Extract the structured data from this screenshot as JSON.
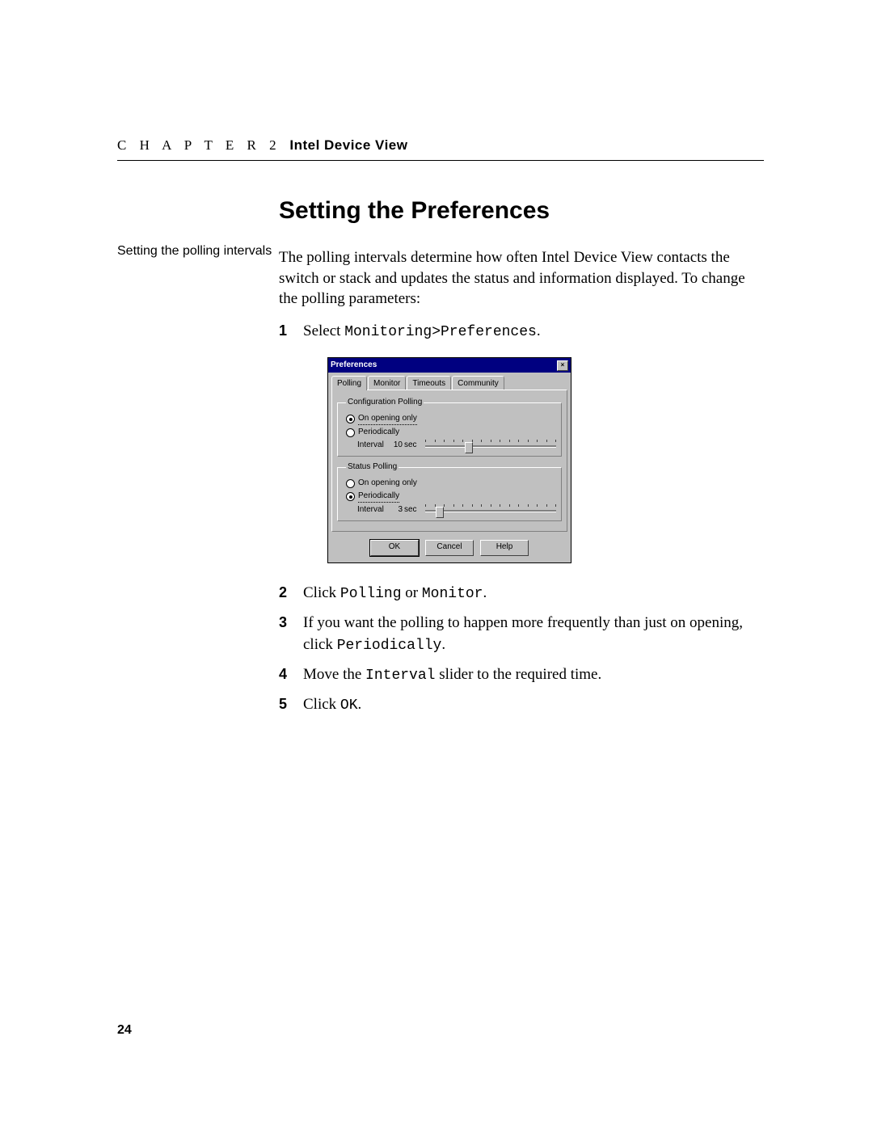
{
  "header": {
    "chapter": "C H A P T E R 2",
    "title": "Intel Device View"
  },
  "page_number": "24",
  "section_title": "Setting the Preferences",
  "sidebar_note": "Setting the polling intervals",
  "intro": "The polling intervals determine how often Intel Device View contacts the switch or stack and updates the status and information displayed. To change the polling parameters:",
  "steps": {
    "s1_pre": "Select ",
    "s1_mono": "Monitoring>Preferences",
    "s1_post": ".",
    "s2_pre": "Click ",
    "s2_mono1": "Polling",
    "s2_mid": " or ",
    "s2_mono2": "Monitor",
    "s2_post": ".",
    "s3_pre": "If you want the polling to happen more frequently than just on opening, click ",
    "s3_mono": "Periodically",
    "s3_post": ".",
    "s4_pre": "Move the ",
    "s4_mono": "Interval",
    "s4_post": " slider to the required time.",
    "s5_pre": "Click ",
    "s5_mono": "OK",
    "s5_post": "."
  },
  "dialog": {
    "title": "Preferences",
    "tabs": [
      "Polling",
      "Monitor",
      "Timeouts",
      "Community"
    ],
    "active_tab": "Polling",
    "group1": {
      "legend": "Configuration Polling",
      "opt_open": "On opening only",
      "opt_periodic": "Periodically",
      "selected": "open",
      "interval_label": "Interval",
      "interval_value": "10",
      "interval_unit": "sec",
      "slider_pos_pct": 30
    },
    "group2": {
      "legend": "Status Polling",
      "opt_open": "On opening only",
      "opt_periodic": "Periodically",
      "selected": "periodic",
      "interval_label": "Interval",
      "interval_value": "3",
      "interval_unit": "sec",
      "slider_pos_pct": 8
    },
    "buttons": {
      "ok": "OK",
      "cancel": "Cancel",
      "help": "Help"
    }
  }
}
